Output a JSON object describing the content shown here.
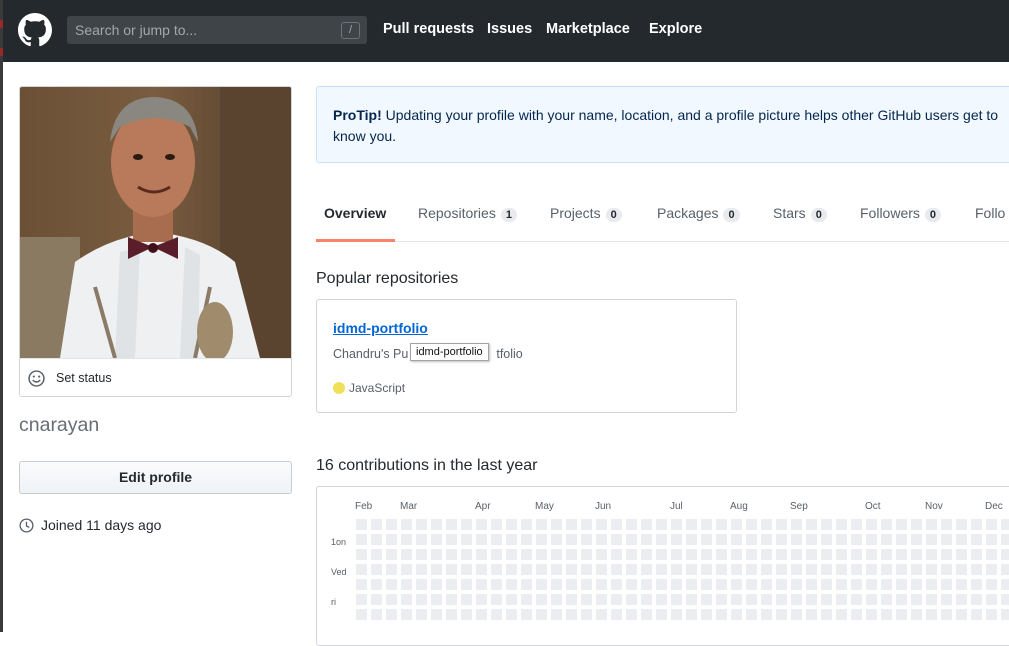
{
  "header": {
    "search_placeholder": "Search or jump to...",
    "search_shortcut": "/",
    "nav": [
      "Pull requests",
      "Issues",
      "Marketplace",
      "Explore"
    ]
  },
  "sidebar": {
    "set_status": "Set status",
    "username": "cnarayan",
    "edit_profile": "Edit profile",
    "joined": "Joined 11 days ago"
  },
  "protip": {
    "lead": "ProTip!",
    "text": " Updating your profile with your name, location, and a profile picture helps other GitHub users get to know you."
  },
  "tabs": [
    {
      "label": "Overview",
      "count": null
    },
    {
      "label": "Repositories",
      "count": "1"
    },
    {
      "label": "Projects",
      "count": "0"
    },
    {
      "label": "Packages",
      "count": "0"
    },
    {
      "label": "Stars",
      "count": "0"
    },
    {
      "label": "Followers",
      "count": "0"
    },
    {
      "label": "Follo",
      "count": null
    }
  ],
  "popular": {
    "title": "Popular repositories",
    "repo_name": "idmd-portfolio",
    "repo_desc_start": "Chandru's Pu",
    "repo_desc_end": "tfolio",
    "tooltip": "idmd-portfolio",
    "language": "JavaScript",
    "language_color": "#f1e05a"
  },
  "contributions": {
    "title": "16 contributions in the last year",
    "months": [
      "Feb",
      "Mar",
      "Apr",
      "May",
      "Jun",
      "Jul",
      "Aug",
      "Sep",
      "Oct",
      "Nov",
      "Dec"
    ],
    "weekdays": [
      "Mon",
      "Wed",
      "Fri"
    ],
    "weekday_visible": [
      "1on",
      "Ved",
      "ri"
    ]
  }
}
